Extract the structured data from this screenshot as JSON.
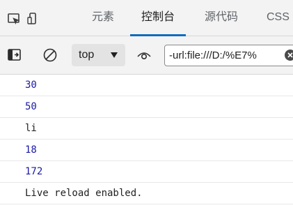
{
  "tabs": [
    {
      "label": "元素",
      "active": false
    },
    {
      "label": "控制台",
      "active": true
    },
    {
      "label": "源代码",
      "active": false
    },
    {
      "label": "CSS",
      "active": false
    }
  ],
  "toolbar": {
    "context": "top",
    "filter_value": "-url:file:///D:/%E7%"
  },
  "console": {
    "lines": [
      {
        "text": "30",
        "kind": "number"
      },
      {
        "text": "50",
        "kind": "number"
      },
      {
        "text": "li",
        "kind": "string"
      },
      {
        "text": "18",
        "kind": "number"
      },
      {
        "text": "172",
        "kind": "number"
      },
      {
        "text": "Live reload enabled.",
        "kind": "string"
      }
    ]
  },
  "colors": {
    "accent": "#0f6cbd",
    "number": "#1a1aa6",
    "text": "#1f1f1f"
  }
}
